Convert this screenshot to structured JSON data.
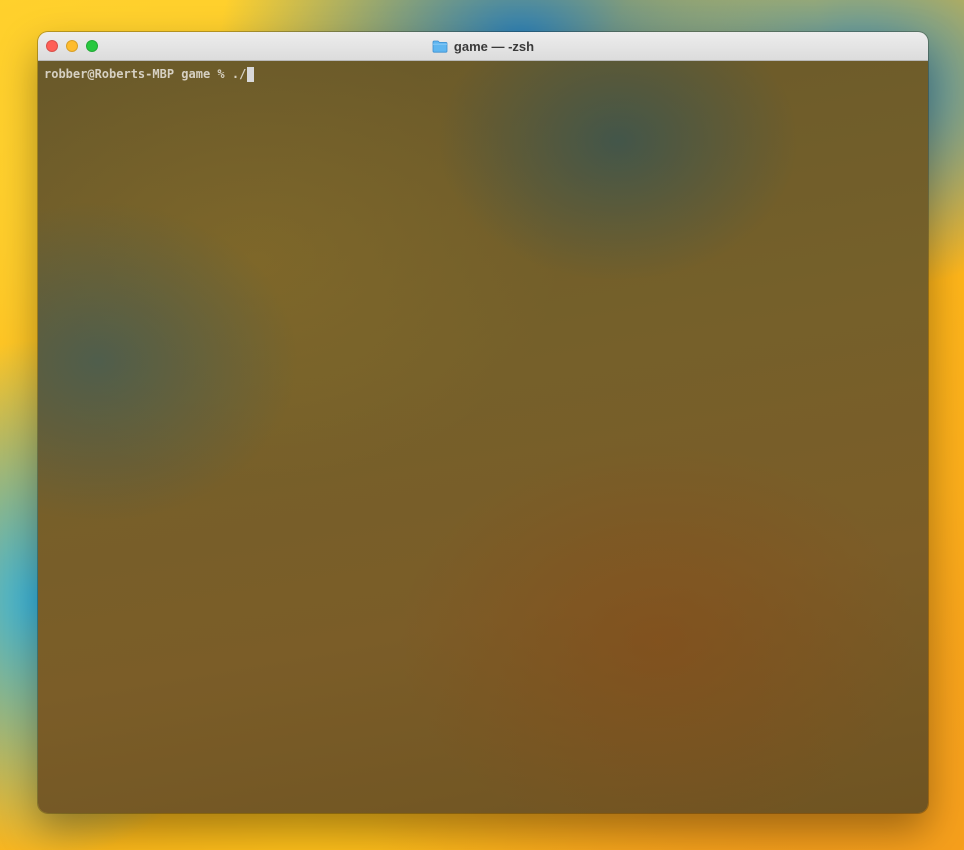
{
  "window": {
    "title": "game — -zsh",
    "folder_icon": "folder-icon"
  },
  "terminal": {
    "prompt": "robber@Roberts-MBP game % ",
    "input": "./"
  },
  "colors": {
    "close": "#ff5f57",
    "minimize": "#febc2e",
    "maximize": "#28c840",
    "folder": "#5fb6f0",
    "terminal_text": "#d6d0c2"
  }
}
